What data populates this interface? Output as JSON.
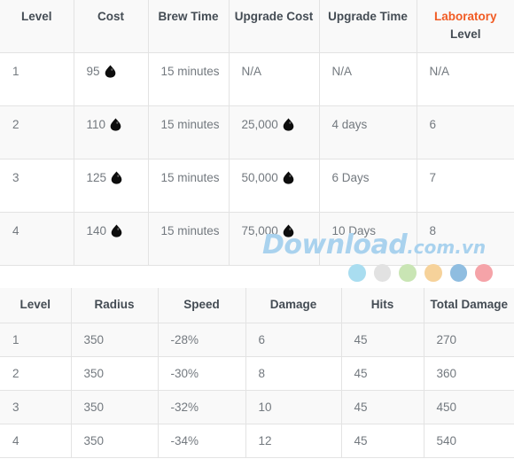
{
  "tables": [
    {
      "id": "spell-levels",
      "headers": [
        {
          "text": "Level",
          "accent": false
        },
        {
          "text": "Cost",
          "accent": false
        },
        {
          "text": "Brew Time",
          "accent": false
        },
        {
          "text": "Upgrade Cost",
          "accent": false
        },
        {
          "text": "Upgrade Time",
          "accent": false
        },
        {
          "text": "Laboratory Level",
          "accent": true,
          "accent_word": "Laboratory",
          "plain_word": "Level"
        }
      ],
      "rows": [
        {
          "level": "1",
          "cost": "95",
          "cost_icon": "dark-elixir-droplet-icon",
          "brew_time": "15 minutes",
          "upgrade_cost": "N/A",
          "upgrade_cost_icon": "",
          "upgrade_time": "N/A",
          "laboratory_level": "N/A"
        },
        {
          "level": "2",
          "cost": "110",
          "cost_icon": "dark-elixir-droplet-icon",
          "brew_time": "15 minutes",
          "upgrade_cost": "25,000",
          "upgrade_cost_icon": "dark-elixir-droplet-icon",
          "upgrade_time": "4 days",
          "laboratory_level": "6"
        },
        {
          "level": "3",
          "cost": "125",
          "cost_icon": "dark-elixir-droplet-icon",
          "brew_time": "15 minutes",
          "upgrade_cost": "50,000",
          "upgrade_cost_icon": "dark-elixir-droplet-icon",
          "upgrade_time": "6 Days",
          "laboratory_level": "7"
        },
        {
          "level": "4",
          "cost": "140",
          "cost_icon": "dark-elixir-droplet-icon",
          "brew_time": "15 minutes",
          "upgrade_cost": "75,000",
          "upgrade_cost_icon": "dark-elixir-droplet-icon",
          "upgrade_time": "10 Days",
          "laboratory_level": "8"
        }
      ]
    },
    {
      "id": "spell-effects",
      "headers": [
        {
          "text": "Level",
          "accent": false
        },
        {
          "text": "Radius",
          "accent": false
        },
        {
          "text": "Speed",
          "accent": false
        },
        {
          "text": "Damage",
          "accent": false
        },
        {
          "text": "Hits",
          "accent": false
        },
        {
          "text": "Total Damage",
          "accent": false
        }
      ],
      "rows": [
        {
          "level": "1",
          "radius": "350",
          "speed": "-28%",
          "damage": "6",
          "hits": "45",
          "total_damage": "270"
        },
        {
          "level": "2",
          "radius": "350",
          "speed": "-30%",
          "damage": "8",
          "hits": "45",
          "total_damage": "360"
        },
        {
          "level": "3",
          "radius": "350",
          "speed": "-32%",
          "damage": "10",
          "hits": "45",
          "total_damage": "450"
        },
        {
          "level": "4",
          "radius": "350",
          "speed": "-34%",
          "damage": "12",
          "hits": "45",
          "total_damage": "540"
        }
      ]
    }
  ],
  "watermark": {
    "name": "Download",
    "tld": ".com.vn",
    "dot_colors": [
      "#a9ddf0",
      "#e2e2e2",
      "#c9e5b4",
      "#f6d29a",
      "#8fbde0",
      "#f5a3a8"
    ]
  },
  "colors": {
    "accent": "#f15b23",
    "header_text": "#444c54",
    "body_text": "#73797f",
    "border": "#e3e3e3",
    "stripe": "#f9f9f9",
    "watermark_blue": "#a9d2ee"
  }
}
